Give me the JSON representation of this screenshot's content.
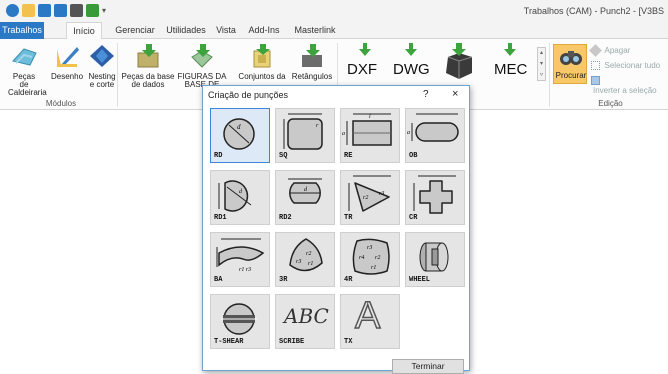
{
  "window": {
    "title": "Trabalhos (CAM) - Punch2 - [V3BS"
  },
  "tabs": [
    {
      "label": "Trabalhos"
    },
    {
      "label": "Início"
    },
    {
      "label": "Gerenciar"
    },
    {
      "label": "Utilidades"
    },
    {
      "label": "Vista"
    },
    {
      "label": "Add-Ins"
    },
    {
      "label": "Masterlink"
    }
  ],
  "ribbon": {
    "modules": {
      "group_label": "Módulos",
      "buttons": [
        {
          "line1": "Peças de",
          "line2": "Caldeiraria",
          "icon": "sheet-metal-icon"
        },
        {
          "line1": "Desenho",
          "line2": "",
          "icon": "drawing-icon"
        },
        {
          "line1": "Nesting",
          "line2": "e corte",
          "icon": "nesting-icon"
        }
      ]
    },
    "database": {
      "buttons": [
        {
          "line1": "Peças da base",
          "line2": "de dados",
          "icon": "parts-db-icon"
        },
        {
          "line1": "FIGURAS DA",
          "line2": "BASE DE",
          "icon": "figures-db-icon"
        },
        {
          "line1": "Conjuntos da",
          "line2": "",
          "icon": "assemblies-db-icon"
        },
        {
          "line1": "Retângulos",
          "line2": "",
          "icon": "rectangles-icon"
        }
      ]
    },
    "import": {
      "buttons": [
        {
          "label": "DXF",
          "icon": "import-dxf-icon"
        },
        {
          "label": "DWG",
          "icon": "import-dwg-icon"
        },
        {
          "label": "",
          "icon": "import-3d-icon"
        },
        {
          "label": "MEC",
          "icon": "import-mec-icon"
        }
      ]
    },
    "edit": {
      "group_label": "Edição",
      "search_label": "Procurar",
      "delete_label": "Apagar",
      "select_all_label": "Selecionar tudo",
      "invert_label": "Inverter a seleção"
    }
  },
  "dialog": {
    "title": "Criação de punções",
    "help": "?",
    "close": "×",
    "tools": [
      {
        "code": "RD",
        "icon": "round-punch-icon"
      },
      {
        "code": "SQ",
        "icon": "square-punch-icon"
      },
      {
        "code": "RE",
        "icon": "rectangle-punch-icon"
      },
      {
        "code": "OB",
        "icon": "obround-punch-icon"
      },
      {
        "code": "RD1",
        "icon": "round-one-flat-punch-icon"
      },
      {
        "code": "RD2",
        "icon": "round-two-flat-punch-icon"
      },
      {
        "code": "TR",
        "icon": "triangle-punch-icon"
      },
      {
        "code": "CR",
        "icon": "cross-punch-icon"
      },
      {
        "code": "BA",
        "icon": "banana-punch-icon"
      },
      {
        "code": "3R",
        "icon": "three-radius-punch-icon"
      },
      {
        "code": "4R",
        "icon": "four-radius-punch-icon"
      },
      {
        "code": "WHEEL",
        "icon": "wheel-punch-icon"
      },
      {
        "code": "T-SHEAR",
        "icon": "t-shear-punch-icon"
      },
      {
        "code": "SCRIBE",
        "icon": "scribe-punch-icon"
      },
      {
        "code": "TX",
        "icon": "text-punch-icon"
      }
    ],
    "scribe_text": "ABC",
    "tx_letter": "A",
    "finish_label": "Terminar"
  }
}
